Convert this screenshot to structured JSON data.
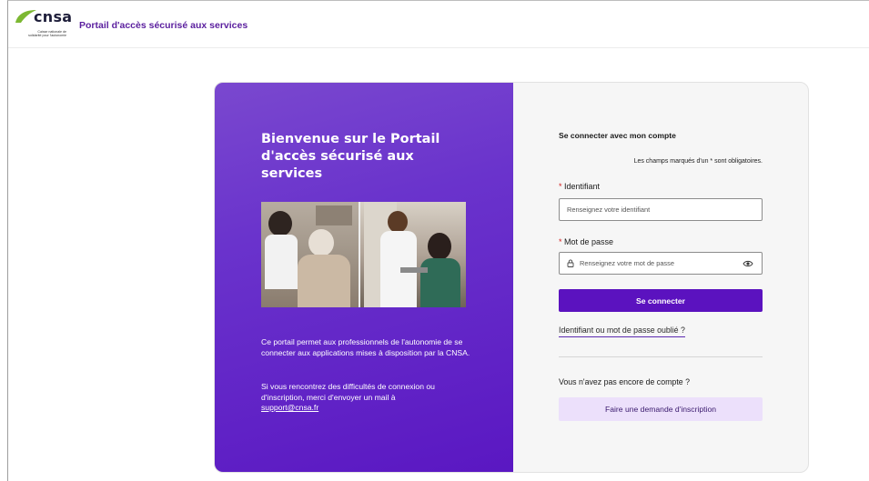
{
  "header": {
    "logo_text": "cnsa",
    "logo_subtitle": "Caisse nationale de solidarité pour l'autonomie",
    "title": "Portail d'accès sécurisé aux services"
  },
  "welcome": {
    "heading": "Bienvenue sur le Portail d'accès sécurisé aux services",
    "paragraph1": "Ce portail permet aux professionnels de l'autonomie de se connecter aux applications mises à disposition par la CNSA.",
    "paragraph2": "Si vous rencontrez des difficultés de connexion ou d'inscription, merci d'envoyer un mail à",
    "support_email": "support@cnsa.fr"
  },
  "login": {
    "title": "Se connecter avec mon compte",
    "required_note": "Les champs marqués d'un * sont obligatoires.",
    "username_label": "Identifiant",
    "username_placeholder": "Renseignez votre identifiant",
    "password_label": "Mot de passe",
    "password_placeholder": "Renseignez votre mot de passe",
    "required_marker": "*",
    "submit_label": "Se connecter",
    "forgot_link": "Identifiant ou mot de passe oublié ?",
    "no_account_text": "Vous n'avez pas encore de compte ?",
    "register_label": "Faire une demande d'inscription"
  },
  "colors": {
    "brand_purple": "#5b12bf",
    "brand_green": "#7cb832",
    "register_bg": "#ece0fb"
  }
}
